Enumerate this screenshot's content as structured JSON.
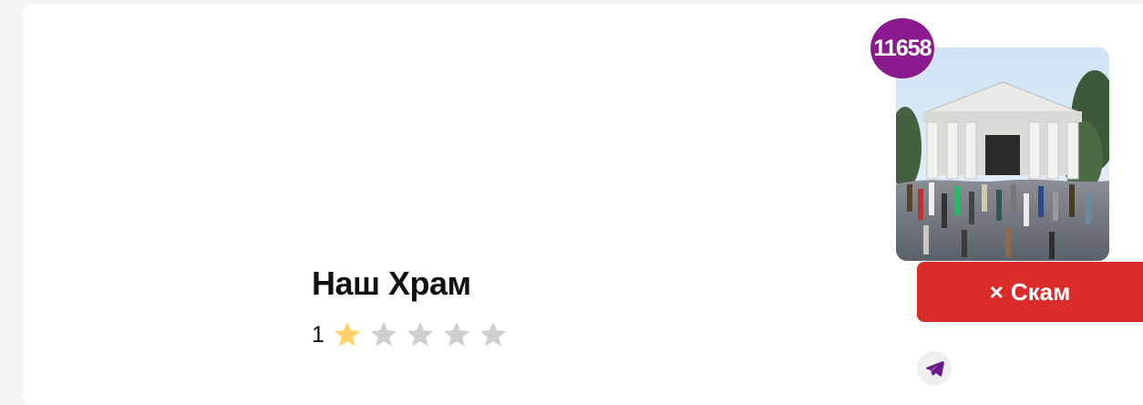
{
  "project": {
    "badge_number": "11658",
    "title": "Наш Храм",
    "rating_count": "1",
    "rating_filled": 1,
    "rating_max": 5,
    "thumbnail_desc": "temple-render-image"
  },
  "actions": {
    "scam_icon": "×",
    "scam_label": "Скам",
    "telegram_icon": "telegram-icon"
  },
  "colors": {
    "badge": "#8a1a8e",
    "scam_button": "#da2c2a",
    "star_filled": "#ffd36b",
    "star_empty": "#cfcfcf",
    "telegram": "#6a1b8a"
  }
}
